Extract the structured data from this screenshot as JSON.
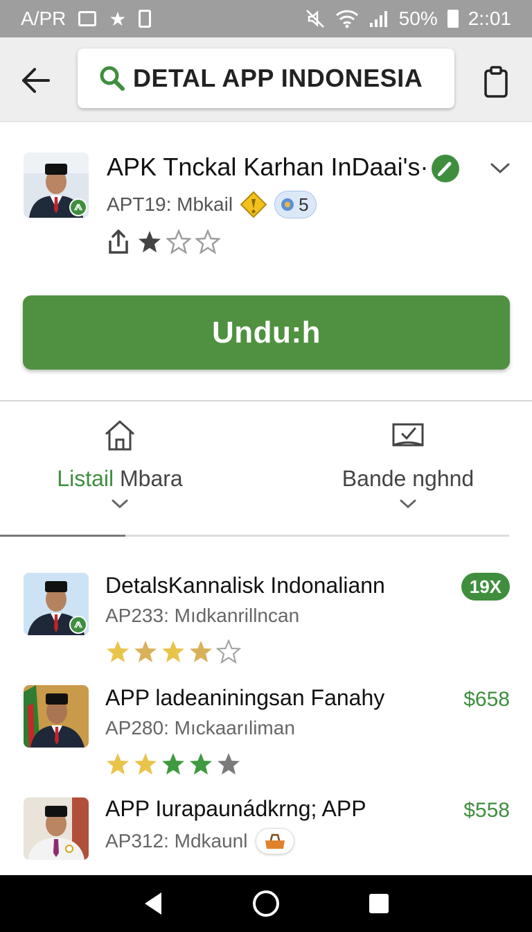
{
  "status_bar": {
    "left_text": "A/PR",
    "battery_text": "50%",
    "time": "2::01",
    "icons": [
      "screen-icon",
      "star-icon",
      "lock-icon",
      "mute-icon",
      "wifi-icon",
      "signal-icon",
      "battery-icon"
    ]
  },
  "top_bar": {
    "search_text": "DETAL APP INDONESIA",
    "icons": [
      "back-arrow-icon",
      "search-icon",
      "clipboard-icon"
    ]
  },
  "app_header": {
    "title": "APK Tnckal Karhan InDaai's·",
    "subtitle": "APT19: Mbkail",
    "count": "5",
    "avatar_badge": "⨇",
    "rating": 1,
    "max_rating": 3,
    "download_label": "Undu:h",
    "colors": {
      "accent": "#4f9140",
      "verified": "#3e8e3e"
    }
  },
  "tabs": [
    {
      "label_accent": "Listail",
      "label_rest": " Mbara",
      "icon": "home-icon",
      "active": true
    },
    {
      "label_accent": "",
      "label_rest": "Bande nghnd",
      "icon": "inbox-icon",
      "active": false
    }
  ],
  "list_items": [
    {
      "title": "DetalsKannalisk Indonaliann",
      "subtitle": "AP233: Mıdkanrillncan",
      "badge": "19X",
      "price": "",
      "avatar_badge": "⨇",
      "stars": [
        "gold",
        "gold-half",
        "gold",
        "gold-half",
        "empty"
      ]
    },
    {
      "title": "APP ladeaniningsan Fanahy",
      "subtitle": "AP280: Mıckaarıliman",
      "badge": "",
      "price": "$658",
      "stars": [
        "gold",
        "gold",
        "green",
        "green",
        "grey"
      ]
    },
    {
      "title": "APP Iurapaunádkrng; APP",
      "subtitle": "AP312: Mdkaunl",
      "badge": "",
      "price": "$558",
      "has_bag": true
    }
  ],
  "nav_bar": {
    "icons": [
      "back-triangle-icon",
      "home-circle-icon",
      "recents-square-icon"
    ]
  }
}
